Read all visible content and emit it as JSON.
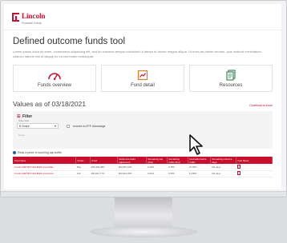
{
  "brand": {
    "name": "Lincoln",
    "sub": "Financial Group"
  },
  "page": {
    "title": "Defined outcome funds tool",
    "description": "Lorem ipsum dolor sit amet, consectetur adipiscing elit, sed do eiusmod tempor incididunt ut labore et dolore magna aliqua. Ut enim ad minim veniam, quis nostrud exercitation ullamco laboris nisi ut aliquip ex ea commodo consequat."
  },
  "cards": [
    {
      "label": "Funds overview",
      "icon": "gauge-icon"
    },
    {
      "label": "Fund detail",
      "icon": "chart-document-icon"
    },
    {
      "label": "Resources",
      "icon": "documents-icon"
    }
  ],
  "values": {
    "title": "Values as of 03/18/2021",
    "download": "Download to excel"
  },
  "filter": {
    "title": "Filter",
    "share_label": "Share class",
    "share_value": "B Share",
    "checkbox_label": "Include eLVF® Advantage",
    "reset": "Reset"
  },
  "note": "Read a piece to touching cap buffer",
  "table": {
    "headers": [
      "Fund name",
      "Series",
      "Fund",
      "Reference index adjustment",
      "Remaining cap (Net)",
      "Remaining buffer (Net)",
      "Downside before buffer",
      "Remaining outcome days",
      "Fact Sheet"
    ],
    "rows": [
      [
        "Lincoln S&P 500 Ultra Buffer Fund Mar",
        "May",
        "$19,325.38%",
        "$19,567.44%",
        "2.29%",
        "0.75%",
        "15.30%",
        "311 days",
        ""
      ],
      [
        "Lincoln S&P 500 Ultra Buffer Fund Feb",
        "Feb",
        "$20,012.77%",
        "$19,524.45%",
        "3.64%",
        "0.65%",
        "14.80%",
        "311 days",
        ""
      ]
    ]
  },
  "colors": {
    "accent": "#c8102e",
    "info": "#1f5fa8"
  }
}
